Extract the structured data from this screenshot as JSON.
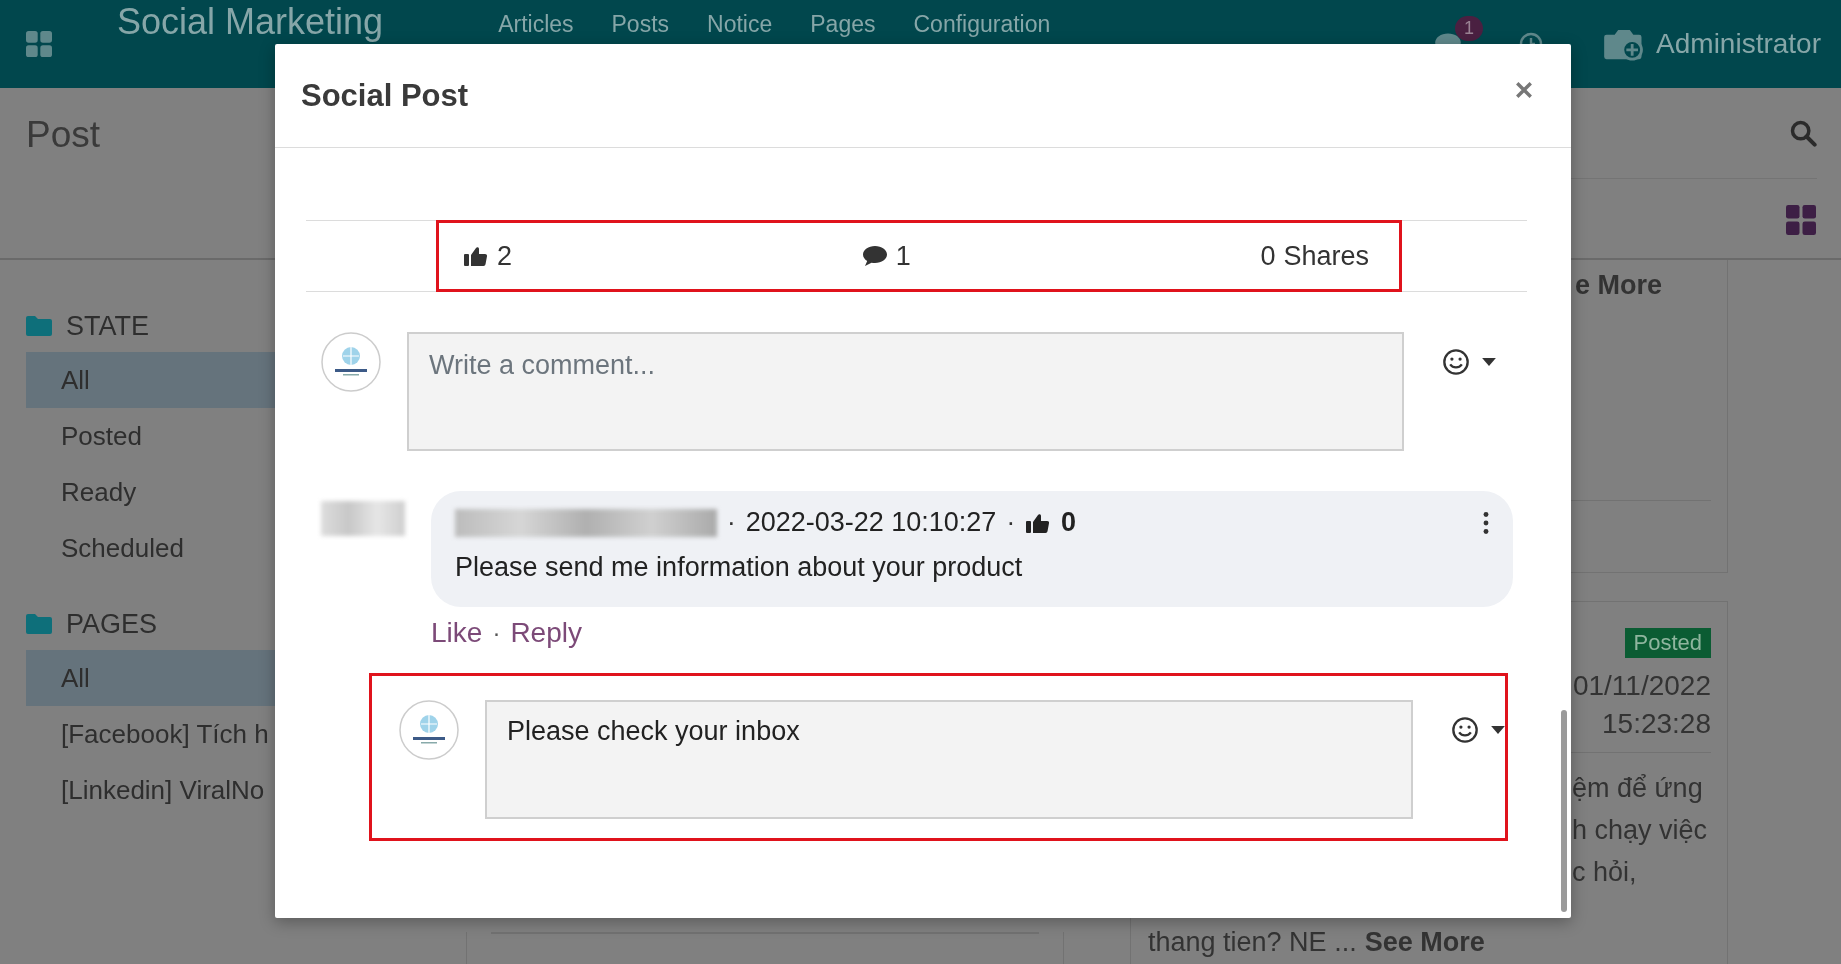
{
  "navbar": {
    "app_title": "Social Marketing",
    "menu": [
      "Articles",
      "Posts",
      "Notice",
      "Pages",
      "Configuration"
    ],
    "message_count": "1",
    "user": "Administrator"
  },
  "control_panel": {
    "title": "Post"
  },
  "sidebar": {
    "sections": [
      {
        "title": "STATE",
        "items": [
          {
            "label": "All",
            "selected": true
          },
          {
            "label": "Posted",
            "selected": false
          },
          {
            "label": "Ready",
            "selected": false
          },
          {
            "label": "Scheduled",
            "selected": false
          }
        ]
      },
      {
        "title": "PAGES",
        "items": [
          {
            "label": "All",
            "selected": true
          },
          {
            "label": "[Facebook] Tích h",
            "selected": false
          },
          {
            "label": "[Linkedin] ViralNo",
            "selected": false
          }
        ]
      }
    ]
  },
  "kanban": {
    "card_top": {
      "link": "e More"
    },
    "card_bottom": {
      "status": "Posted",
      "date": "01/11/2022",
      "time": "15:23:28",
      "lines": [
        "ệm để ứng",
        "h chạy việc",
        "c hỏi,"
      ],
      "last_line": "thang tien? NE ...",
      "link": "See More"
    }
  },
  "modal": {
    "title": "Social Post",
    "stats": {
      "highlighted": true,
      "likes": "2",
      "comments": "1",
      "shares_count": "0",
      "shares_label": "Shares"
    },
    "composer": {
      "placeholder": "Write a comment..."
    },
    "comments": [
      {
        "date": "2022-03-22 10:10:27",
        "likes": "0",
        "meta_separators": [
          "·",
          "·"
        ],
        "text": "Please send me information about your product",
        "actions": [
          "Like",
          "Reply"
        ],
        "action_separators": [
          "·"
        ]
      }
    ],
    "reply": {
      "highlighted": true,
      "value": "Please check your inbox"
    }
  }
}
